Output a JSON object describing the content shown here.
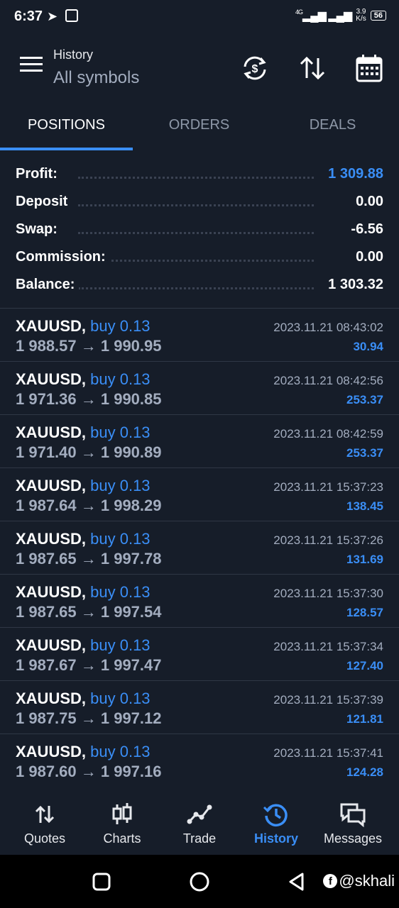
{
  "status_bar": {
    "time": "6:37",
    "network": "4G",
    "speed_value": "3.9",
    "speed_unit": "K/s",
    "battery": "56"
  },
  "header": {
    "title": "History",
    "subtitle": "All symbols",
    "icons": [
      "currency-exchange-icon",
      "sort-icon",
      "calendar-icon"
    ]
  },
  "tabs": [
    {
      "label": "POSITIONS",
      "active": true
    },
    {
      "label": "ORDERS",
      "active": false
    },
    {
      "label": "DEALS",
      "active": false
    }
  ],
  "summary": {
    "profit_label": "Profit:",
    "profit_value": "1 309.88",
    "deposit_label": "Deposit",
    "deposit_value": "0.00",
    "swap_label": "Swap:",
    "swap_value": "-6.56",
    "commission_label": "Commission:",
    "commission_value": "0.00",
    "balance_label": "Balance:",
    "balance_value": "1 303.32"
  },
  "positions": [
    {
      "symbol": "XAUUSD,",
      "side": "buy 0.13",
      "prices": "1 988.57 → 1 990.95",
      "time": "2023.11.21 08:43:02",
      "profit": "30.94"
    },
    {
      "symbol": "XAUUSD,",
      "side": "buy 0.13",
      "prices": "1 971.36 → 1 990.85",
      "time": "2023.11.21 08:42:56",
      "profit": "253.37"
    },
    {
      "symbol": "XAUUSD,",
      "side": "buy 0.13",
      "prices": "1 971.40 → 1 990.89",
      "time": "2023.11.21 08:42:59",
      "profit": "253.37"
    },
    {
      "symbol": "XAUUSD,",
      "side": "buy 0.13",
      "prices": "1 987.64 → 1 998.29",
      "time": "2023.11.21 15:37:23",
      "profit": "138.45"
    },
    {
      "symbol": "XAUUSD,",
      "side": "buy 0.13",
      "prices": "1 987.65 → 1 997.78",
      "time": "2023.11.21 15:37:26",
      "profit": "131.69"
    },
    {
      "symbol": "XAUUSD,",
      "side": "buy 0.13",
      "prices": "1 987.65 → 1 997.54",
      "time": "2023.11.21 15:37:30",
      "profit": "128.57"
    },
    {
      "symbol": "XAUUSD,",
      "side": "buy 0.13",
      "prices": "1 987.67 → 1 997.47",
      "time": "2023.11.21 15:37:34",
      "profit": "127.40"
    },
    {
      "symbol": "XAUUSD,",
      "side": "buy 0.13",
      "prices": "1 987.75 → 1 997.12",
      "time": "2023.11.21 15:37:39",
      "profit": "121.81"
    },
    {
      "symbol": "XAUUSD,",
      "side": "buy 0.13",
      "prices": "1 987.60 → 1 997.16",
      "time": "2023.11.21 15:37:41",
      "profit": "124.28"
    }
  ],
  "bottom_nav": [
    {
      "label": "Quotes",
      "icon": "quotes-arrows-icon",
      "active": false
    },
    {
      "label": "Charts",
      "icon": "candlestick-chart-icon",
      "active": false
    },
    {
      "label": "Trade",
      "icon": "trade-line-chart-icon",
      "active": false
    },
    {
      "label": "History",
      "icon": "history-clock-icon",
      "active": true
    },
    {
      "label": "Messages",
      "icon": "messages-chat-icon",
      "active": false
    }
  ],
  "watermark": "@skhali",
  "colors": {
    "background": "#161d29",
    "accent": "#3a8ef6",
    "muted_text": "#a3adbf",
    "divider": "#2f3745"
  }
}
